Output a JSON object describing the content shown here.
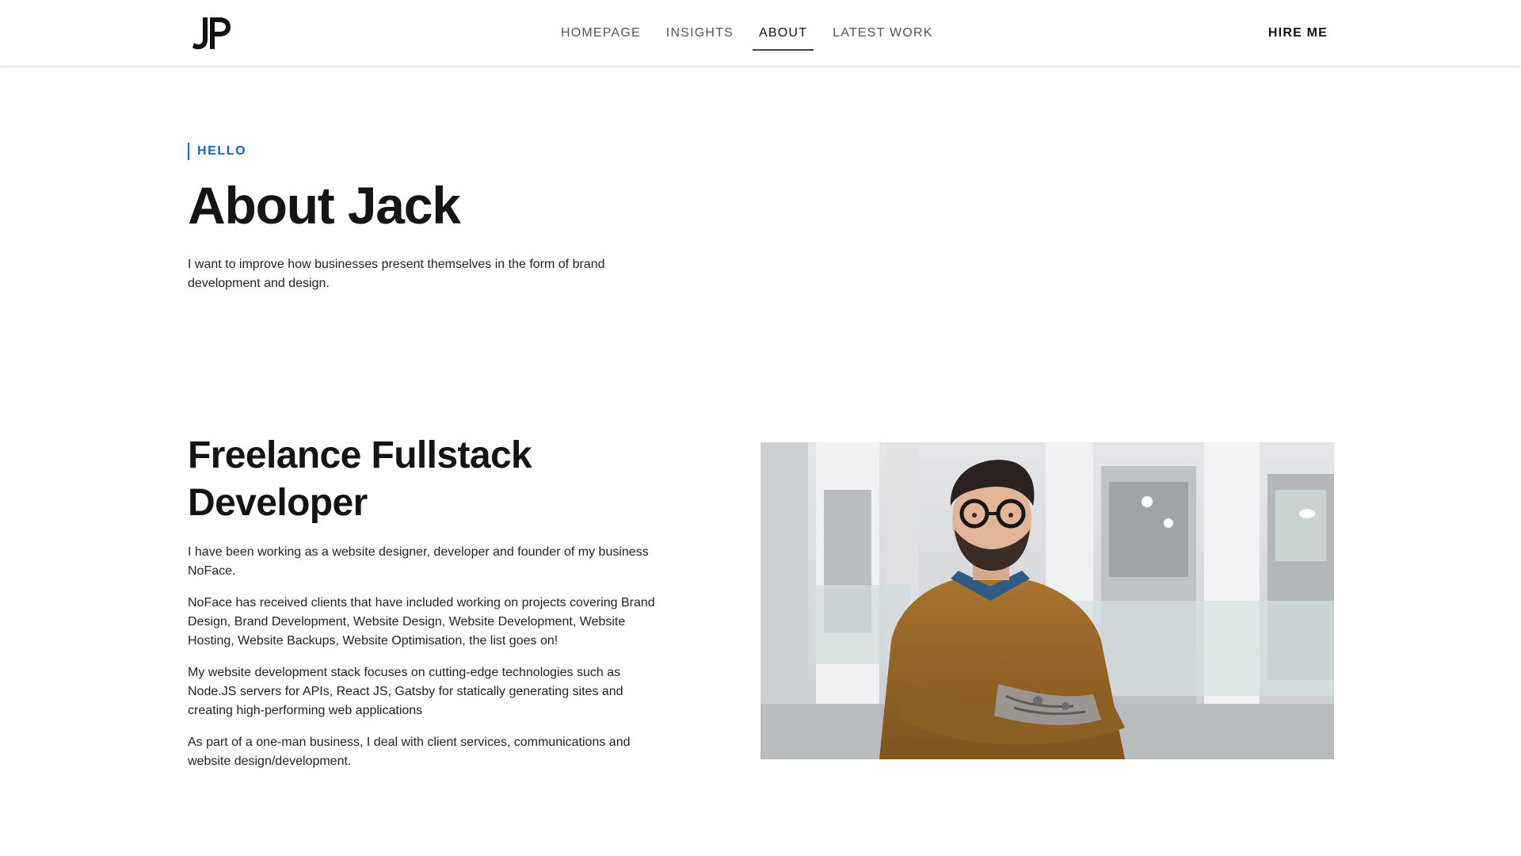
{
  "header": {
    "logo_text": "JP",
    "nav": [
      {
        "label": "HOMEPAGE",
        "active": false
      },
      {
        "label": "INSIGHTS",
        "active": false
      },
      {
        "label": "ABOUT",
        "active": true
      },
      {
        "label": "LATEST WORK",
        "active": false
      }
    ],
    "hire_label": "HIRE ME"
  },
  "intro": {
    "eyebrow": "HELLO",
    "title": "About Jack",
    "text": "I want to improve how businesses present themselves in the form of brand development and design."
  },
  "bio": {
    "title": "Freelance Fullstack Developer",
    "paragraphs": [
      "I have been working as a website designer, developer and founder of my business NoFace.",
      "NoFace has received clients that have included working on projects covering Brand Design, Brand Development, Website Design, Website Development, Website Hosting, Website Backups, Website Optimisation, the list goes on!",
      "My website development stack focuses on cutting-edge technologies such as Node.JS servers for APIs, React JS, Gatsby for statically generating sites and creating high-performing web applications",
      "As part of a one-man business, I deal with client services, communications and website design/development."
    ]
  },
  "colors": {
    "accent": "#1565c0",
    "text": "#141414",
    "sweater": "#9a6a2a"
  }
}
